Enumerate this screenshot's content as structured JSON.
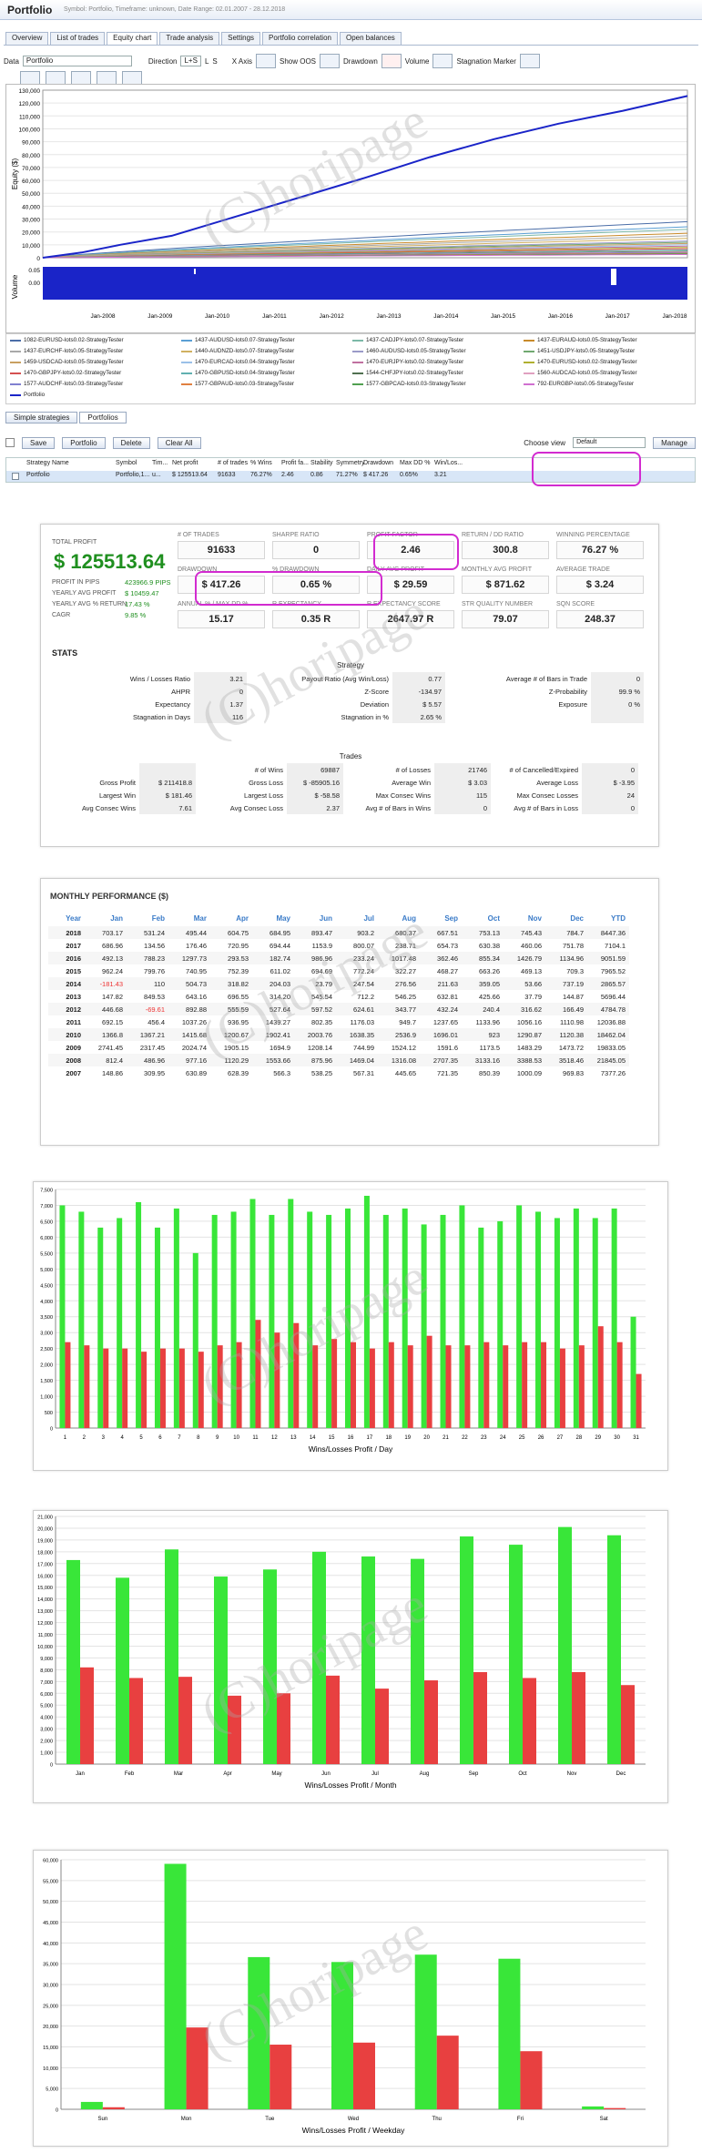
{
  "app": {
    "title": "Portfolio",
    "subtitle": "Symbol: Portfolio, Timeframe: unknown, Date Range: 02.01.2007 - 28.12.2018"
  },
  "tabs": [
    "Overview",
    "List of trades",
    "Equity chart",
    "Trade analysis",
    "Settings",
    "Portfolio correlation",
    "Open balances"
  ],
  "toolbar": {
    "data_label": "Data",
    "data_value": "Portfolio",
    "direction_label": "Direction",
    "dir_opts": [
      "L+S",
      "L",
      "S"
    ],
    "xaxis_label": "X Axis",
    "showoos_label": "Show OOS",
    "drawdown_label": "Drawdown",
    "volume_label": "Volume",
    "stagnation_label": "Stagnation Marker"
  },
  "equity_chart": {
    "ylabel": "Equity ($)",
    "yticks": [
      "130,000",
      "120,000",
      "110,000",
      "100,000",
      "90,000",
      "80,000",
      "70,000",
      "60,000",
      "50,000",
      "40,000",
      "30,000",
      "20,000",
      "10,000",
      "0"
    ],
    "vol_label": "Volume",
    "vol_ticks": [
      "0.05",
      "0.00"
    ],
    "xticks": [
      "Jan-2008",
      "Jan-2009",
      "Jan-2010",
      "Jan-2011",
      "Jan-2012",
      "Jan-2013",
      "Jan-2014",
      "Jan-2015",
      "Jan-2016",
      "Jan-2017",
      "Jan-2018"
    ],
    "accent": "#1a24c8"
  },
  "legend": [
    [
      "1082-EURUSD-lots0.02-StrategyTester",
      "#4b6ea8"
    ],
    [
      "1437-AUDUSD-lots0.07-StrategyTester",
      "#5a9fd4"
    ],
    [
      "1437-CADJPY-lots0.07-StrategyTester",
      "#7cb9a8"
    ],
    [
      "1437-EURAUD-lots0.05-StrategyTester",
      "#c88a2a"
    ],
    [
      "1437-EURCHF-lots0.05-StrategyTester",
      "#a8a8a8"
    ],
    [
      "1440-AUDNZD-lots0.07-StrategyTester",
      "#d0b060"
    ],
    [
      "1460-AUDUSD-lots0.05-StrategyTester",
      "#9a9ac8"
    ],
    [
      "1451-USDJPY-lots0.05-StrategyTester",
      "#70a870"
    ],
    [
      "1459-USDCAD-lots0.05-StrategyTester",
      "#c8a060"
    ],
    [
      "1470-EURCAD-lots0.04-StrategyTester",
      "#9ac0e8"
    ],
    [
      "1470-EURJPY-lots0.02-StrategyTester",
      "#c070a0"
    ],
    [
      "1470-EURUSD-lots0.02-StrategyTester",
      "#b0b030"
    ],
    [
      "1470-GBPJPY-lots0.02-StrategyTester",
      "#d45050"
    ],
    [
      "1470-GBPUSD-lots0.04-StrategyTester",
      "#60b0b0"
    ],
    [
      "1544-CHFJPY-lots0.02-StrategyTester",
      "#507050"
    ],
    [
      "1560-AUDCAD-lots0.05-StrategyTester",
      "#e0a0c0"
    ],
    [
      "1577-AUDCHF-lots0.03-StrategyTester",
      "#8080d0"
    ],
    [
      "1577-GBPAUD-lots0.03-StrategyTester",
      "#e08040"
    ],
    [
      "1577-GBPCAD-lots0.03-StrategyTester",
      "#50a050"
    ],
    [
      "792-EURGBP-lots0.05-StrategyTester",
      "#d070d0"
    ],
    [
      "Portfolio",
      "#1a24c8"
    ]
  ],
  "subtabs": [
    "Simple strategies",
    "Portfolios"
  ],
  "actions": {
    "save": "Save",
    "portfolio": "Portfolio",
    "delete": "Delete",
    "clear": "Clear All",
    "choose_view": "Choose view",
    "view_value": "Default",
    "manage": "Manage"
  },
  "grid": {
    "headers": [
      "Strategy Name",
      "Symbol",
      "Tim...",
      "Net profit",
      "# of trades",
      "% Wins",
      "Profit fa...",
      "Stability",
      "Symmetry",
      "Drawdown",
      "Max DD %",
      "Win/Los..."
    ],
    "row": [
      "Portfolio",
      "Portfolio,1...",
      "u...",
      "$ 125513.64",
      "91633",
      "76.27%",
      "2.46",
      "0.86",
      "71.27%",
      "$ 417.26",
      "0.65%",
      "3.21"
    ]
  },
  "summary": {
    "total_profit_label": "TOTAL PROFIT",
    "total_profit": "$ 125513.64",
    "side": [
      [
        "PROFIT IN PIPS",
        "423966.9 PIPS"
      ],
      [
        "YEARLY AVG PROFIT",
        "$ 10459.47"
      ],
      [
        "YEARLY AVG % RETURN",
        "17.43 %"
      ],
      [
        "CAGR",
        "9.85 %"
      ]
    ],
    "metrics": [
      [
        "# OF TRADES",
        "91633"
      ],
      [
        "SHARPE RATIO",
        "0"
      ],
      [
        "PROFIT FACTOR",
        "2.46"
      ],
      [
        "RETURN / DD RATIO",
        "300.8"
      ],
      [
        "WINNING PERCENTAGE",
        "76.27 %"
      ],
      [
        "DRAWDOWN",
        "$ 417.26"
      ],
      [
        "% DRAWDOWN",
        "0.65 %"
      ],
      [
        "DAILY AVG PROFIT",
        "$ 29.59"
      ],
      [
        "MONTHLY AVG PROFIT",
        "$ 871.62"
      ],
      [
        "AVERAGE TRADE",
        "$ 3.24"
      ],
      [
        "ANNUAL % / MAX DD %",
        "15.17"
      ],
      [
        "R EXPECTANCY",
        "0.35 R"
      ],
      [
        "R EXPECTANCY SCORE",
        "2647.97 R"
      ],
      [
        "STR QUALITY NUMBER",
        "79.07"
      ],
      [
        "SQN SCORE",
        "248.37"
      ]
    ],
    "stats_label": "STATS",
    "strategy_label": "Strategy",
    "trades_label": "Trades",
    "strategy_rows": [
      [
        "Wins / Losses Ratio",
        "3.21",
        "Payout Ratio (Avg Win/Loss)",
        "0.77",
        "Average # of Bars in Trade",
        "0"
      ],
      [
        "AHPR",
        "0",
        "Z-Score",
        "-134.97",
        "Z-Probability",
        "99.9 %"
      ],
      [
        "Expectancy",
        "1.37",
        "Deviation",
        "$ 5.57",
        "Exposure",
        "0 %"
      ],
      [
        "Stagnation in Days",
        "116",
        "Stagnation in %",
        "2.65 %",
        "",
        ""
      ]
    ],
    "trades_rows": [
      [
        "",
        "",
        "# of Wins",
        "69887",
        "# of Losses",
        "21746",
        "# of Cancelled/Expired",
        "0"
      ],
      [
        "Gross Profit",
        "$ 211418.8",
        "Gross Loss",
        "$ -85905.16",
        "Average Win",
        "$ 3.03",
        "Average Loss",
        "$ -3.95"
      ],
      [
        "Largest Win",
        "$ 181.46",
        "Largest Loss",
        "$ -58.58",
        "Max Consec Wins",
        "115",
        "Max Consec Losses",
        "24"
      ],
      [
        "Avg Consec Wins",
        "7.61",
        "Avg Consec Loss",
        "2.37",
        "Avg # of Bars in Wins",
        "0",
        "Avg # of Bars in Loss",
        "0"
      ]
    ]
  },
  "monthly": {
    "title": "MONTHLY PERFORMANCE ($)",
    "headers": [
      "Year",
      "Jan",
      "Feb",
      "Mar",
      "Apr",
      "May",
      "Jun",
      "Jul",
      "Aug",
      "Sep",
      "Oct",
      "Nov",
      "Dec",
      "YTD"
    ],
    "rows": [
      [
        "2018",
        "703.17",
        "531.24",
        "495.44",
        "604.75",
        "684.95",
        "893.47",
        "903.2",
        "680.37",
        "667.51",
        "753.13",
        "745.43",
        "784.7",
        "8447.36"
      ],
      [
        "2017",
        "686.96",
        "134.56",
        "176.46",
        "720.95",
        "694.44",
        "1153.9",
        "800.07",
        "238.71",
        "654.73",
        "630.38",
        "460.06",
        "751.78",
        "7104.1"
      ],
      [
        "2016",
        "492.13",
        "788.23",
        "1297.73",
        "293.53",
        "182.74",
        "986.96",
        "233.24",
        "1017.48",
        "362.46",
        "855.34",
        "1426.79",
        "1134.96",
        "9051.59"
      ],
      [
        "2015",
        "962.24",
        "799.76",
        "740.95",
        "752.39",
        "611.02",
        "694.69",
        "772.24",
        "322.27",
        "468.27",
        "663.26",
        "469.13",
        "709.3",
        "7965.52"
      ],
      [
        "2014",
        "-181.43",
        "110",
        "504.73",
        "318.82",
        "204.03",
        "23.79",
        "247.54",
        "276.56",
        "211.63",
        "359.05",
        "53.66",
        "737.19",
        "2865.57"
      ],
      [
        "2013",
        "147.82",
        "849.53",
        "643.16",
        "696.55",
        "314.20",
        "545.54",
        "712.2",
        "546.25",
        "632.81",
        "425.66",
        "37.79",
        "144.87",
        "5696.44"
      ],
      [
        "2012",
        "446.68",
        "-69.61",
        "892.88",
        "555.59",
        "527.64",
        "597.52",
        "624.61",
        "343.77",
        "432.24",
        "240.4",
        "316.62",
        "166.49",
        "4784.78"
      ],
      [
        "2011",
        "692.15",
        "456.4",
        "1037.26",
        "936.95",
        "1439.27",
        "802.35",
        "1176.03",
        "949.7",
        "1237.65",
        "1133.96",
        "1056.16",
        "1110.98",
        "12036.88"
      ],
      [
        "2010",
        "1366.8",
        "1367.21",
        "1415.68",
        "1200.67",
        "1902.41",
        "2003.76",
        "1638.35",
        "2536.9",
        "1696.01",
        "923",
        "1290.87",
        "1120.38",
        "18462.04"
      ],
      [
        "2009",
        "2741.45",
        "2317.45",
        "2024.74",
        "1905.15",
        "1694.9",
        "1208.14",
        "744.99",
        "1524.12",
        "1591.6",
        "1173.5",
        "1483.29",
        "1473.72",
        "19833.05"
      ],
      [
        "2008",
        "812.4",
        "486.96",
        "977.16",
        "1120.29",
        "1553.66",
        "875.96",
        "1469.04",
        "1316.08",
        "2707.35",
        "3133.16",
        "3388.53",
        "3518.46",
        "21845.05"
      ],
      [
        "2007",
        "148.86",
        "309.95",
        "630.89",
        "628.39",
        "566.3",
        "538.25",
        "567.31",
        "445.65",
        "721.35",
        "850.39",
        "1000.09",
        "969.83",
        "7377.26"
      ]
    ]
  },
  "day_chart": {
    "type": "bar",
    "xlabel": "Wins/Losses Profit / Day",
    "yticks": [
      "7,500",
      "7,000",
      "6,500",
      "6,000",
      "5,500",
      "5,000",
      "4,500",
      "4,000",
      "3,500",
      "3,000",
      "2,500",
      "2,000",
      "1,500",
      "1,000",
      "500",
      "0"
    ],
    "ylim": [
      0,
      7500
    ],
    "categories": [
      "1",
      "2",
      "3",
      "4",
      "5",
      "6",
      "7",
      "8",
      "9",
      "10",
      "11",
      "12",
      "13",
      "14",
      "15",
      "16",
      "17",
      "18",
      "19",
      "20",
      "21",
      "22",
      "23",
      "24",
      "25",
      "26",
      "27",
      "28",
      "29",
      "30",
      "31"
    ],
    "series": [
      {
        "values": [
          7000,
          6800,
          6300,
          6600,
          7100,
          6300,
          6900,
          5500,
          6700,
          6800,
          7200,
          6700,
          7200,
          6800,
          6700,
          6900,
          7300,
          6700,
          6900,
          6400,
          6700,
          7000,
          6300,
          6500,
          7000,
          6800,
          6600,
          6900,
          6600,
          6900,
          3500
        ]
      },
      {
        "values": [
          2700,
          2600,
          2500,
          2500,
          2400,
          2500,
          2500,
          2400,
          2600,
          2700,
          3400,
          3000,
          3300,
          2600,
          2800,
          2700,
          2500,
          2700,
          2600,
          2900,
          2600,
          2600,
          2700,
          2600,
          2700,
          2700,
          2500,
          2600,
          3200,
          2700,
          1700
        ]
      }
    ]
  },
  "month_chart": {
    "type": "bar",
    "xlabel": "Wins/Losses Profit / Month",
    "yticks": [
      "21,000",
      "20,000",
      "19,000",
      "18,000",
      "17,000",
      "16,000",
      "15,000",
      "14,000",
      "13,000",
      "12,000",
      "11,000",
      "10,000",
      "9,000",
      "8,000",
      "7,000",
      "6,000",
      "5,000",
      "4,000",
      "3,000",
      "2,000",
      "1,000",
      "0"
    ],
    "ylim": [
      0,
      21000
    ],
    "categories": [
      "Jan",
      "Feb",
      "Mar",
      "Apr",
      "May",
      "Jun",
      "Jul",
      "Aug",
      "Sep",
      "Oct",
      "Nov",
      "Dec"
    ],
    "series": [
      {
        "values": [
          17300,
          15800,
          18200,
          15900,
          16500,
          18000,
          17600,
          17400,
          19300,
          18600,
          20100,
          19400
        ]
      },
      {
        "values": [
          8200,
          7300,
          7400,
          5800,
          6000,
          7500,
          6400,
          7100,
          7800,
          7300,
          7800,
          6700
        ]
      }
    ]
  },
  "weekday_chart": {
    "type": "bar",
    "xlabel": "Wins/Losses Profit / Weekday",
    "yticks": [
      "60,000",
      "55,000",
      "50,000",
      "45,000",
      "40,000",
      "35,000",
      "30,000",
      "25,000",
      "20,000",
      "15,000",
      "10,000",
      "5,000",
      "0"
    ],
    "ylim": [
      0,
      61000
    ],
    "categories": [
      "Sun",
      "Mon",
      "Tue",
      "Wed",
      "Thu",
      "Fri",
      "Sat"
    ],
    "series": [
      {
        "values": [
          1800,
          60000,
          37200,
          36000,
          37800,
          36800,
          700
        ]
      },
      {
        "values": [
          500,
          20000,
          15800,
          16300,
          18000,
          14200,
          300
        ]
      }
    ]
  },
  "chart_colors": {
    "win": "#39e639",
    "loss": "#e84040"
  },
  "watermark": "(C)horipage"
}
